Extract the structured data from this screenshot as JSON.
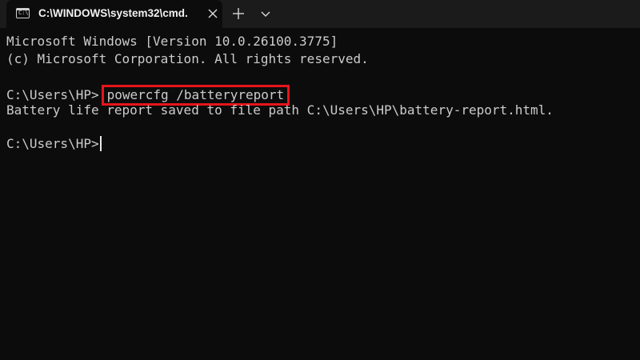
{
  "window": {
    "tab_title": "C:\\WINDOWS\\system32\\cmd.",
    "tab_icon": "cmd-icon",
    "tab_icon_glyph": "C:\\",
    "close_icon": "close-icon",
    "new_tab_icon": "plus-icon",
    "dropdown_icon": "chevron-down-icon"
  },
  "terminal": {
    "header_line_1": "Microsoft Windows [Version 10.0.26100.3775]",
    "header_line_2": "(c) Microsoft Corporation. All rights reserved.",
    "prompt_1": "C:\\Users\\HP>",
    "command": "powercfg /batteryreport",
    "output": "Battery life report saved to file path C:\\Users\\HP\\battery-report.html.",
    "prompt_2": "C:\\Users\\HP>"
  },
  "colors": {
    "background": "#0c0c0c",
    "titlebar": "#1b1b1b",
    "text": "#cccccc",
    "highlight_border": "#e8141b"
  }
}
